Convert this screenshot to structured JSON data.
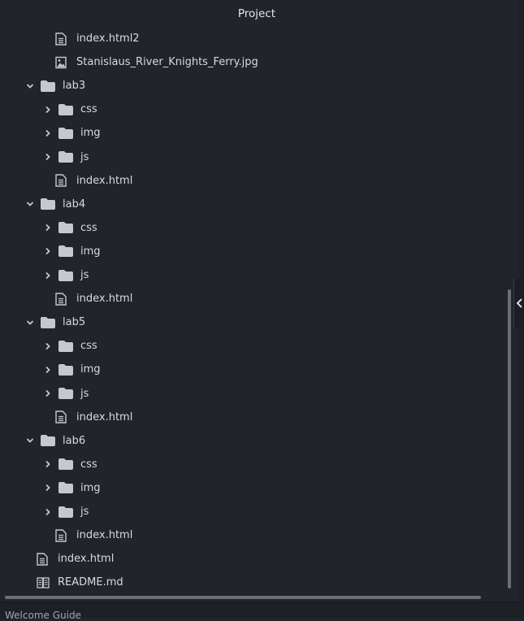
{
  "panel": {
    "title": "Project"
  },
  "tree": [
    {
      "label": "index.html2",
      "type": "file",
      "depth": 2
    },
    {
      "label": "Stanislaus_River_Knights_Ferry.jpg",
      "type": "image",
      "depth": 2
    },
    {
      "label": "lab3",
      "type": "folder",
      "depth": 0,
      "expanded": true
    },
    {
      "label": "css",
      "type": "folder",
      "depth": 1,
      "expanded": false
    },
    {
      "label": "img",
      "type": "folder",
      "depth": 1,
      "expanded": false
    },
    {
      "label": "js",
      "type": "folder",
      "depth": 1,
      "expanded": false
    },
    {
      "label": "index.html",
      "type": "file",
      "depth": 2
    },
    {
      "label": "lab4",
      "type": "folder",
      "depth": 0,
      "expanded": true
    },
    {
      "label": "css",
      "type": "folder",
      "depth": 1,
      "expanded": false
    },
    {
      "label": "img",
      "type": "folder",
      "depth": 1,
      "expanded": false
    },
    {
      "label": "js",
      "type": "folder",
      "depth": 1,
      "expanded": false
    },
    {
      "label": "index.html",
      "type": "file",
      "depth": 2
    },
    {
      "label": "lab5",
      "type": "folder",
      "depth": 0,
      "expanded": true
    },
    {
      "label": "css",
      "type": "folder",
      "depth": 1,
      "expanded": false
    },
    {
      "label": "img",
      "type": "folder",
      "depth": 1,
      "expanded": false
    },
    {
      "label": "js",
      "type": "folder",
      "depth": 1,
      "expanded": false
    },
    {
      "label": "index.html",
      "type": "file",
      "depth": 2
    },
    {
      "label": "lab6",
      "type": "folder",
      "depth": 0,
      "expanded": true
    },
    {
      "label": "css",
      "type": "folder",
      "depth": 1,
      "expanded": false
    },
    {
      "label": "img",
      "type": "folder",
      "depth": 1,
      "expanded": false
    },
    {
      "label": "js",
      "type": "folder",
      "depth": 1,
      "expanded": false
    },
    {
      "label": "index.html",
      "type": "file",
      "depth": 2
    },
    {
      "label": "index.html",
      "type": "file",
      "depth": 1
    },
    {
      "label": "README.md",
      "type": "book",
      "depth": 1
    }
  ],
  "statusbar": {
    "text": "Welcome Guide"
  },
  "colors": {
    "background": "#21252b",
    "text": "#d7dae0",
    "icon": "#c5c8ce",
    "scrollbar": "#6b6f77"
  }
}
